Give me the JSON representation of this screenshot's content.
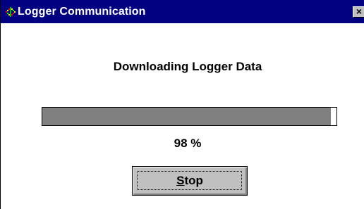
{
  "window": {
    "title": "Logger Communication",
    "app_icon": "logger-app-icon",
    "close_icon": "close-icon",
    "close_label": "×"
  },
  "dialog": {
    "message": "Downloading Logger Data",
    "progress_percent": 98,
    "progress_text": "98 %",
    "stop_button": {
      "mnemonic": "S",
      "rest": "top",
      "full_label": "Stop"
    }
  },
  "colors": {
    "titlebar": "#000080",
    "title_text": "#ffffff",
    "progress_fill": "#808080",
    "progress_track": "#ffffff",
    "button_face": "#c0c0c0"
  }
}
